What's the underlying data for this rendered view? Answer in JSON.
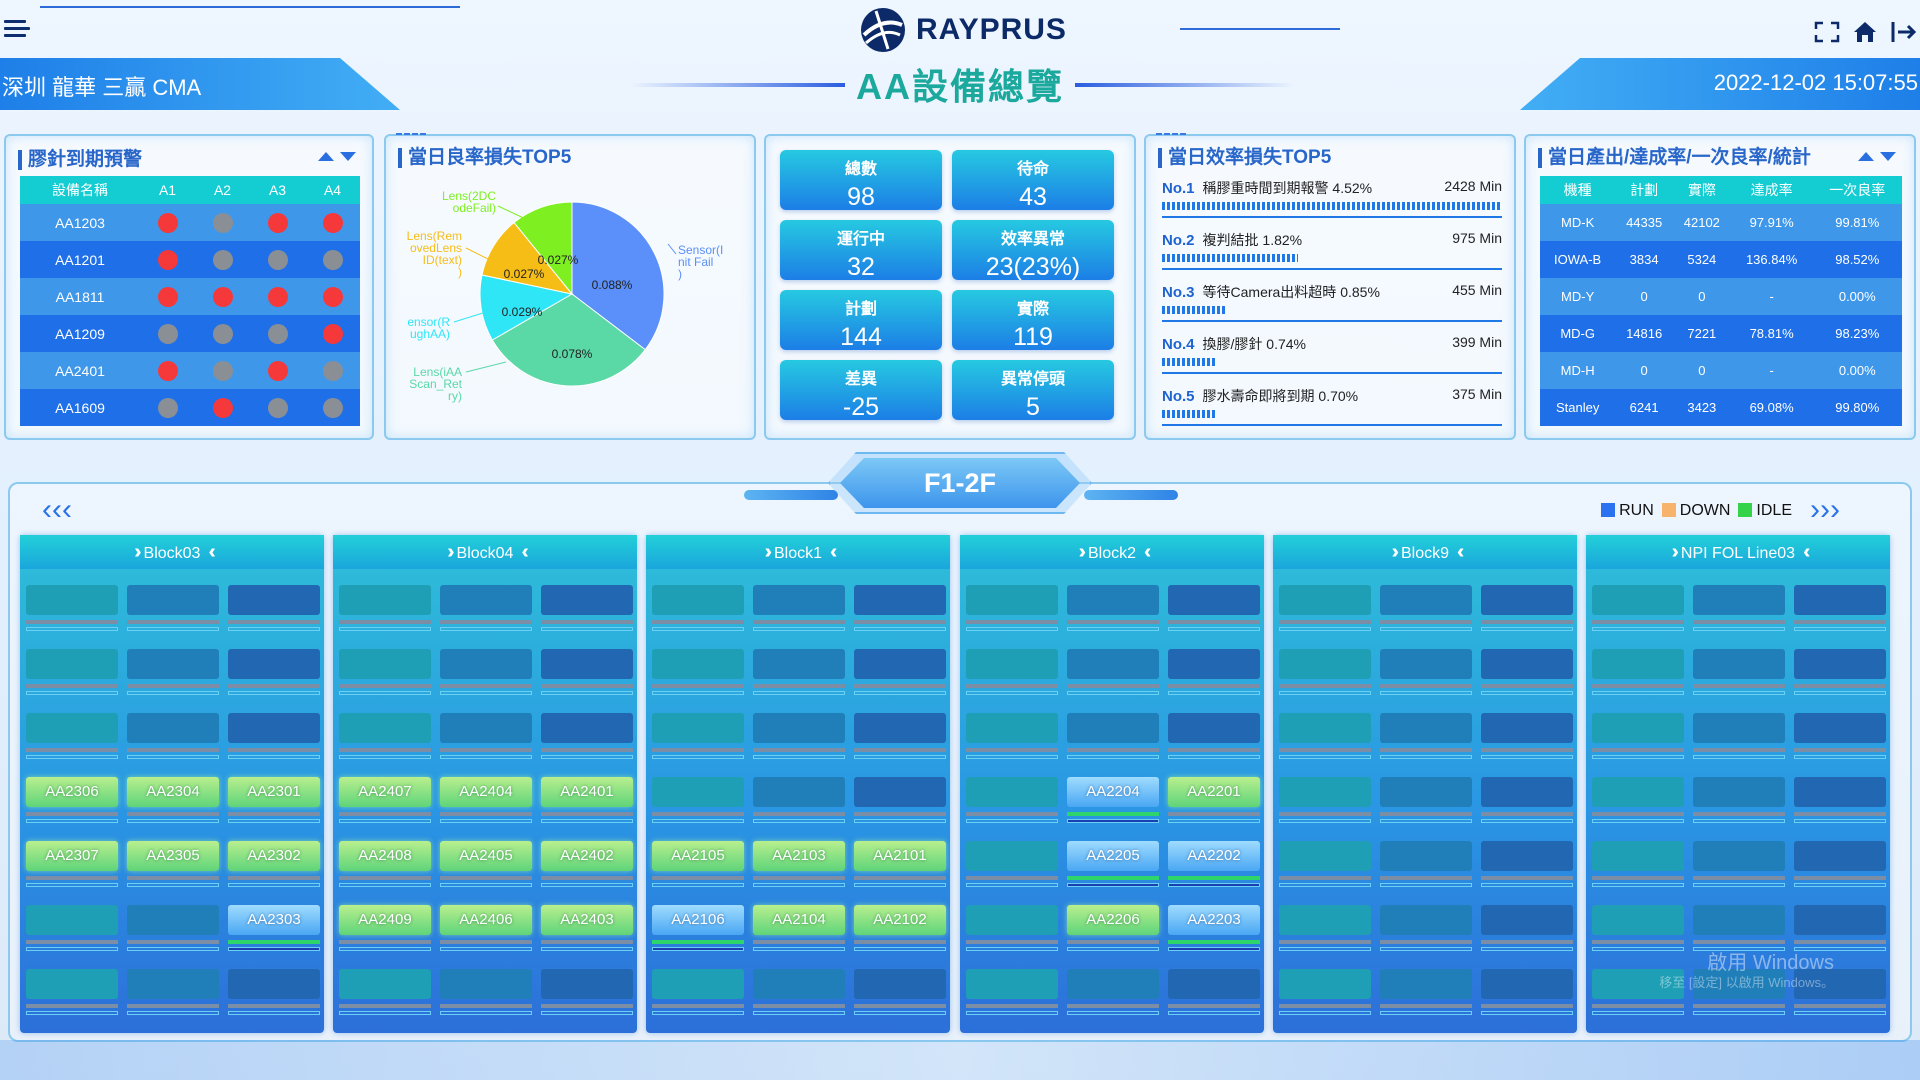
{
  "header": {
    "logo_text": "RAYPRUS",
    "title": "AA設備總覽",
    "site": "深圳 龍華 三贏 CMA",
    "datetime": "2022-12-02 15:07:55"
  },
  "glue_panel": {
    "title": "膠針到期預警",
    "columns": [
      "設備名稱",
      "A1",
      "A2",
      "A3",
      "A4"
    ],
    "rows": [
      {
        "name": "AA1203",
        "dots": [
          "red",
          "gray",
          "red",
          "red"
        ]
      },
      {
        "name": "AA1201",
        "dots": [
          "red",
          "gray",
          "gray",
          "gray"
        ]
      },
      {
        "name": "AA1811",
        "dots": [
          "red",
          "red",
          "red",
          "red"
        ]
      },
      {
        "name": "AA1209",
        "dots": [
          "gray",
          "gray",
          "gray",
          "red"
        ]
      },
      {
        "name": "AA2401",
        "dots": [
          "red",
          "gray",
          "red",
          "gray"
        ]
      },
      {
        "name": "AA1609",
        "dots": [
          "gray",
          "red",
          "gray",
          "gray"
        ]
      }
    ]
  },
  "yield_panel": {
    "title": "當日良率損失TOP5",
    "chart_data": {
      "type": "pie",
      "slices": [
        {
          "label": "Sensor(Init Fail)",
          "value": 0.088,
          "value_label": "0.088%",
          "color": "#5b8ff9"
        },
        {
          "label": "Lens(iAA Scan_Retry)",
          "value": 0.078,
          "value_label": "0.078%",
          "color": "#5ad8a6"
        },
        {
          "label": "Sensor(Rough AA)",
          "value": 0.029,
          "value_label": "0.029%",
          "color": "#2fe6f6"
        },
        {
          "label": "Lens(Removed Lens ID(text))",
          "value": 0.027,
          "value_label": "0.027%",
          "color": "#f6bd16"
        },
        {
          "label": "Lens(2DCode Fail)",
          "value": 0.027,
          "value_label": "0.027%",
          "color": "#7ef021"
        }
      ],
      "outer_labels": {
        "s0": [
          "Sensor(I",
          "nit Fail",
          ")"
        ],
        "s1": [
          "Lens(iAA",
          "Scan_Ret",
          "ry)"
        ],
        "s2": [
          "ensor(R",
          "ughAA)"
        ],
        "s3": [
          "Lens(Rem",
          "ovedLens",
          "ID(text)",
          ")"
        ],
        "s4": [
          "Lens(2DC",
          "odeFail)"
        ]
      }
    }
  },
  "stats": [
    {
      "label": "總數",
      "value": "98"
    },
    {
      "label": "待命",
      "value": "43"
    },
    {
      "label": "運行中",
      "value": "32"
    },
    {
      "label": "效率異常",
      "value": "23(23%)"
    },
    {
      "label": "計劃",
      "value": "144"
    },
    {
      "label": "實際",
      "value": "119"
    },
    {
      "label": "差異",
      "value": "-25"
    },
    {
      "label": "異常停頭",
      "value": "5"
    }
  ],
  "efficiency_panel": {
    "title": "當日效率損失TOP5",
    "items": [
      {
        "no": "No.1",
        "text": "稱膠重時間到期報警 4.52%",
        "value": "2428 Min",
        "ratio": 1.0
      },
      {
        "no": "No.2",
        "text": "複判結批 1.82%",
        "value": "975 Min",
        "ratio": 0.4
      },
      {
        "no": "No.3",
        "text": "等待Camera出料超時 0.85%",
        "value": "455 Min",
        "ratio": 0.19
      },
      {
        "no": "No.4",
        "text": "換膠/膠針 0.74%",
        "value": "399 Min",
        "ratio": 0.16
      },
      {
        "no": "No.5",
        "text": "膠水壽命即將到期 0.70%",
        "value": "375 Min",
        "ratio": 0.155
      }
    ]
  },
  "output_panel": {
    "title": "當日產出/達成率/一次良率/統計",
    "columns": [
      "機種",
      "計劃",
      "實際",
      "達成率",
      "一次良率"
    ],
    "rows": [
      [
        "MD-K",
        "44335",
        "42102",
        "97.91%",
        "99.81%"
      ],
      [
        "IOWA-B",
        "3834",
        "5324",
        "136.84%",
        "98.52%"
      ],
      [
        "MD-Y",
        "0",
        "0",
        "-",
        "0.00%"
      ],
      [
        "MD-G",
        "14816",
        "7221",
        "78.81%",
        "98.23%"
      ],
      [
        "MD-H",
        "0",
        "0",
        "-",
        "0.00%"
      ],
      [
        "Stanley",
        "6241",
        "3423",
        "69.08%",
        "99.80%"
      ]
    ]
  },
  "floor": {
    "label": "F1-2F",
    "legend": [
      {
        "label": "RUN",
        "color": "#2a72f0"
      },
      {
        "label": "DOWN",
        "color": "#f7b26b"
      },
      {
        "label": "IDLE",
        "color": "#34d34a"
      }
    ]
  },
  "blocks": [
    {
      "name": "Block03",
      "cells": {
        "3-0": [
          "AA2306",
          "run"
        ],
        "3-1": [
          "AA2304",
          "run"
        ],
        "3-2": [
          "AA2301",
          "run"
        ],
        "4-0": [
          "AA2307",
          "run"
        ],
        "4-1": [
          "AA2305",
          "run"
        ],
        "4-2": [
          "AA2302",
          "run"
        ],
        "5-2": [
          "AA2303",
          "idle"
        ]
      }
    },
    {
      "name": "Block04",
      "cells": {
        "3-0": [
          "AA2407",
          "run"
        ],
        "3-1": [
          "AA2404",
          "run"
        ],
        "3-2": [
          "AA2401",
          "run"
        ],
        "4-0": [
          "AA2408",
          "run"
        ],
        "4-1": [
          "AA2405",
          "run"
        ],
        "4-2": [
          "AA2402",
          "run"
        ],
        "5-0": [
          "AA2409",
          "run"
        ],
        "5-1": [
          "AA2406",
          "run"
        ],
        "5-2": [
          "AA2403",
          "run"
        ]
      }
    },
    {
      "name": "Block1",
      "cells": {
        "4-0": [
          "AA2105",
          "run"
        ],
        "4-1": [
          "AA2103",
          "run"
        ],
        "4-2": [
          "AA2101",
          "run"
        ],
        "5-0": [
          "AA2106",
          "idle"
        ],
        "5-1": [
          "AA2104",
          "run"
        ],
        "5-2": [
          "AA2102",
          "run"
        ]
      }
    },
    {
      "name": "Block2",
      "cells": {
        "3-1": [
          "AA2204",
          "idle"
        ],
        "3-2": [
          "AA2201",
          "run"
        ],
        "4-1": [
          "AA2205",
          "idle"
        ],
        "4-2": [
          "AA2202",
          "idle"
        ],
        "5-1": [
          "AA2206",
          "run"
        ],
        "5-2": [
          "AA2203",
          "idle"
        ]
      }
    },
    {
      "name": "Block9",
      "cells": {}
    },
    {
      "name": "NPI FOL Line03",
      "cells": {}
    }
  ],
  "watermark": {
    "line1": "啟用 Windows",
    "line2": "移至 [設定] 以啟用 Windows。"
  }
}
